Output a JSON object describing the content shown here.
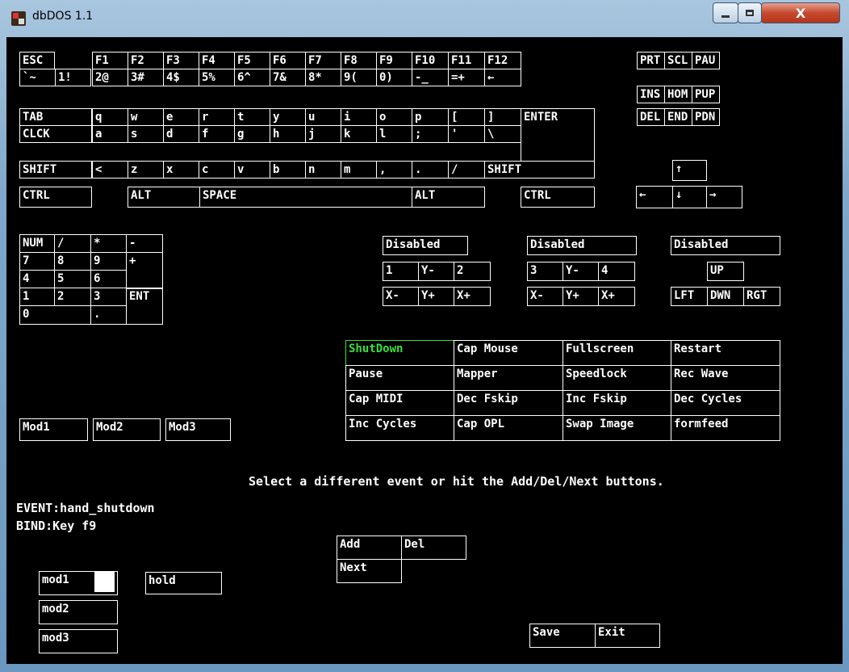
{
  "window": {
    "title": "dbDOS 1.1",
    "minimize": "minimize",
    "maximize": "maximize",
    "close_glyph": "X"
  },
  "keyboard": {
    "row_function": [
      "ESC",
      "F1",
      "F2",
      "F3",
      "F4",
      "F5",
      "F6",
      "F7",
      "F8",
      "F9",
      "F10",
      "F11",
      "F12"
    ],
    "row_number": [
      "`~",
      "1!",
      "2@",
      "3#",
      "4$",
      "5%",
      "6^",
      "7&",
      "8*",
      "9(",
      "0)",
      "-_",
      "=+",
      "←"
    ],
    "row_tab": [
      "TAB",
      "q",
      "w",
      "e",
      "r",
      "t",
      "y",
      "u",
      "i",
      "o",
      "p",
      "[",
      "]"
    ],
    "row_caps": [
      "CLCK",
      "a",
      "s",
      "d",
      "f",
      "g",
      "h",
      "j",
      "k",
      "l",
      ";",
      "'",
      "\\"
    ],
    "row_shift": [
      "SHIFT",
      "<",
      "z",
      "x",
      "c",
      "v",
      "b",
      "n",
      "m",
      ",",
      ".",
      "/"
    ],
    "row_ctrl": [
      "CTRL",
      "ALT",
      "SPACE",
      "ALT",
      "CTRL"
    ],
    "enter": "ENTER",
    "shift_right": "SHIFT",
    "system": [
      "PRT",
      "SCL",
      "PAU"
    ],
    "nav1": [
      "INS",
      "HOM",
      "PUP"
    ],
    "nav2": [
      "DEL",
      "END",
      "PDN"
    ],
    "arrows": {
      "up": "↑",
      "left": "←",
      "down": "↓",
      "right": "→"
    }
  },
  "numpad": {
    "row1": [
      "NUM",
      "/",
      "*",
      "-"
    ],
    "row2": [
      "7",
      "8",
      "9",
      "+"
    ],
    "row3": [
      "4",
      "5",
      "6"
    ],
    "row4": [
      "1",
      "2",
      "3",
      "ENT"
    ],
    "row5": [
      "0",
      "."
    ]
  },
  "joystick1": {
    "status": "Disabled",
    "keys": [
      "1",
      "Y-",
      "2",
      "X-",
      "Y+",
      "X+"
    ]
  },
  "joystick2": {
    "status": "Disabled",
    "keys": [
      "3",
      "Y-",
      "4",
      "X-",
      "Y+",
      "X+"
    ]
  },
  "joystick3": {
    "status": "Disabled",
    "keys": [
      "UP",
      "LFT",
      "DWN",
      "RGT"
    ]
  },
  "events": [
    [
      "ShutDown",
      "Cap Mouse",
      "Fullscreen",
      "Restart"
    ],
    [
      "Pause",
      "Mapper",
      "Speedlock",
      "Rec Wave"
    ],
    [
      "Cap MIDI",
      "Dec Fskip",
      "Inc Fskip",
      "Dec Cycles"
    ],
    [
      "Inc Cycles",
      "Cap OPL",
      "Swap Image",
      "formfeed"
    ]
  ],
  "selected_event_color": "#38e038",
  "mods": [
    "Mod1",
    "Mod2",
    "Mod3"
  ],
  "status_message": "Select a different event or hit the Add/Del/Next buttons.",
  "event_line": "EVENT:hand_shutdown",
  "bind_line": "BIND:Key f9",
  "actions": {
    "add": "Add",
    "del": "Del",
    "next": "Next"
  },
  "bind_mods": {
    "mod1": "mod1",
    "mod2": "mod2",
    "mod3": "mod3",
    "hold": "hold"
  },
  "footer": {
    "save": "Save",
    "exit": "Exit"
  }
}
